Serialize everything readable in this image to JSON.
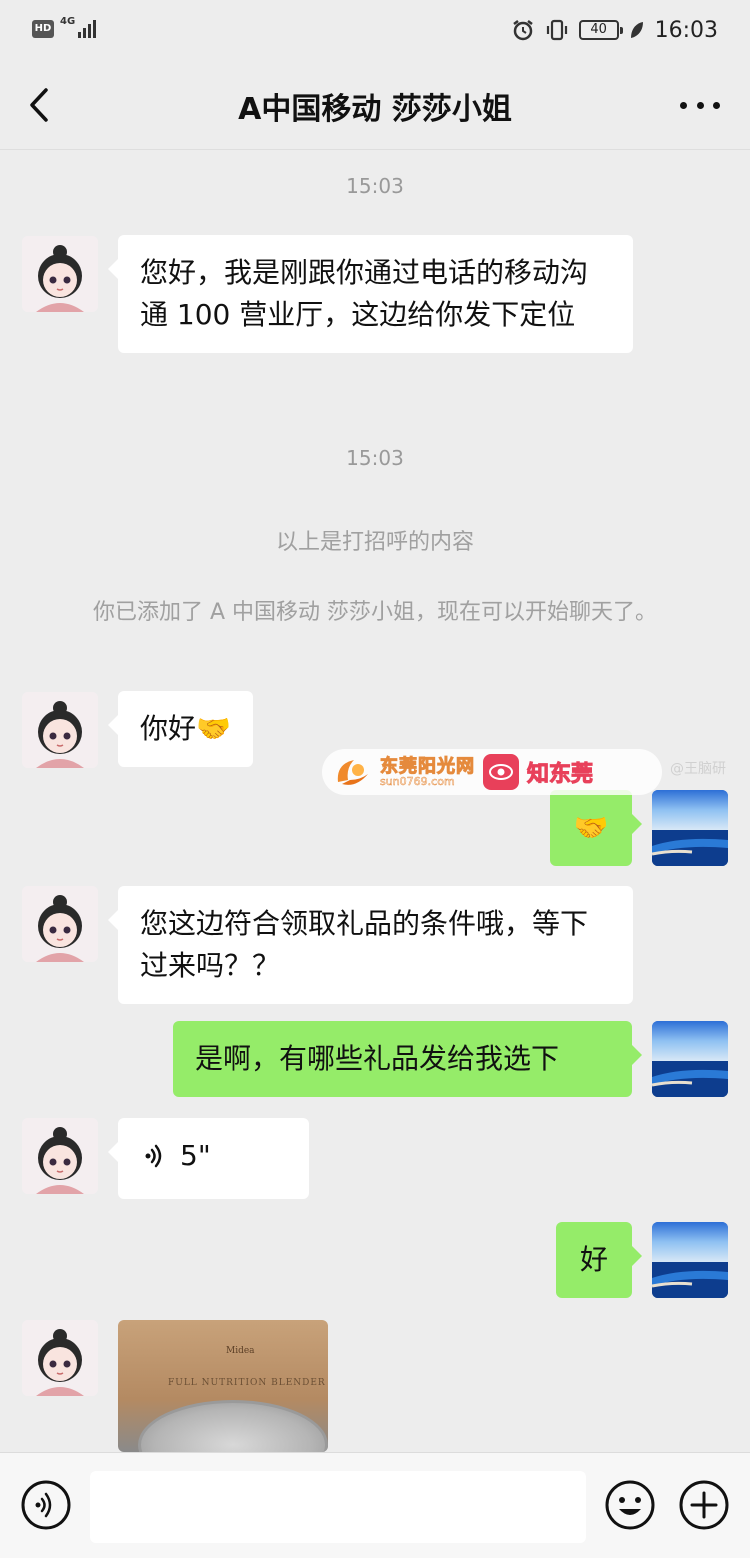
{
  "status_bar": {
    "hd": "HD",
    "network": "4G",
    "battery": "40",
    "time": "16:03"
  },
  "nav": {
    "title": "A中国移动  莎莎小姐"
  },
  "messages": {
    "time1": "15:03",
    "msg1": "您好，我是刚跟你通过电话的移动沟通 100 营业厅，这边给你发下定位",
    "time2": "15:03",
    "sys1": "以上是打招呼的内容",
    "sys2": "你已添加了 A 中国移动  莎莎小姐，现在可以开始聊天了。",
    "msg2": "你好🤝",
    "msg3": "🤝",
    "msg4": "您这边符合领取礼品的条件哦，等下过来吗？？",
    "msg5": "是啊，有哪些礼品发给我选下",
    "voice_duration": "5\"",
    "msg6": "好",
    "image_box_text": "FULL NUTRITION BLENDER",
    "image_box_logo": "Midea"
  },
  "watermark": {
    "site_name": "东莞阳光网",
    "site_url": "sun0769.com",
    "brand": "知东莞",
    "handle": "@王脑研"
  },
  "colors": {
    "background": "#ededed",
    "incoming_bubble": "#ffffff",
    "outgoing_bubble": "#95ec69",
    "system_text": "#a0a0a0"
  },
  "icons": {
    "back": "chevron-left-icon",
    "more": "more-dots-icon",
    "voice_mode": "voice-wave-icon",
    "emoji": "smiley-icon",
    "plus": "plus-circle-icon"
  }
}
